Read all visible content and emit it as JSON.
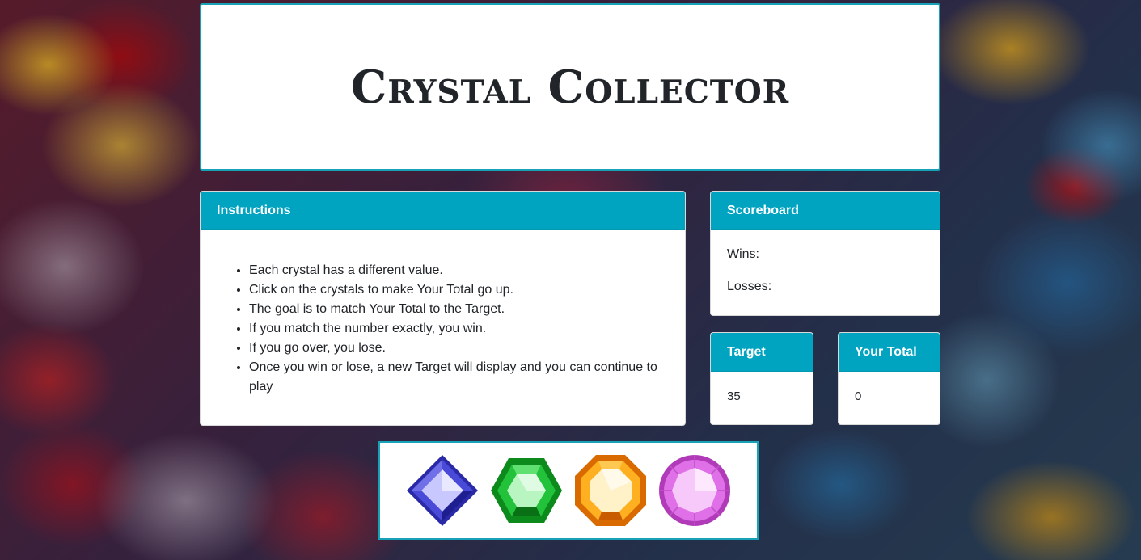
{
  "title": "Crystal Collector",
  "instructions": {
    "header": "Instructions",
    "items": [
      "Each crystal has a different value.",
      "Click on the crystals to make Your Total go up.",
      "The goal is to match Your Total to the Target.",
      "If you match the number exactly, you win.",
      "If you go over, you lose.",
      "Once you win or lose, a new Target will display and you can continue to play"
    ]
  },
  "scoreboard": {
    "header": "Scoreboard",
    "wins_label": "Wins:",
    "losses_label": "Losses:"
  },
  "target": {
    "header": "Target",
    "value": "35"
  },
  "total": {
    "header": "Your Total",
    "value": "0"
  },
  "crystals": [
    {
      "icon": "blue-crystal-icon",
      "color": "#3b3bd6"
    },
    {
      "icon": "green-crystal-icon",
      "color": "#18b02a"
    },
    {
      "icon": "orange-crystal-icon",
      "color": "#f39a0a"
    },
    {
      "icon": "pink-crystal-icon",
      "color": "#e060e0"
    }
  ],
  "colors": {
    "accent": "#00a4c1",
    "border": "#17a2b8"
  }
}
